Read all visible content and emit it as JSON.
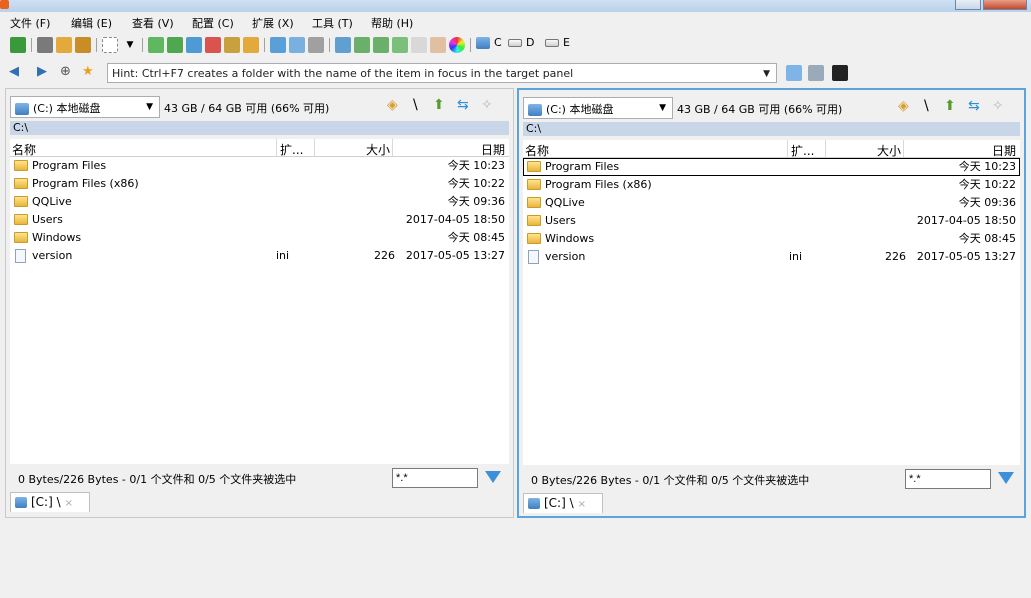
{
  "menu": [
    "文件 (F)",
    "编辑 (E)",
    "查看 (V)",
    "配置 (C)",
    "扩展 (X)",
    "工具 (T)",
    "帮助 (H)"
  ],
  "toolbar": {
    "drives": [
      "C",
      "D",
      "E"
    ]
  },
  "nav": {
    "hint": "Hint: Ctrl+F7 creates a folder with the name of the item in focus in the target panel"
  },
  "left_panel": {
    "drive_label": "(C:) 本地磁盘",
    "drive_info": "43 GB / 64 GB 可用 (66% 可用)",
    "path": "C:\\",
    "columns": {
      "name": "名称",
      "ext": "扩...",
      "size": "大小",
      "date": "日期"
    },
    "rows": [
      {
        "name": "Program Files",
        "ext": "",
        "size": "",
        "date": "今天 10:23",
        "type": "folder"
      },
      {
        "name": "Program Files (x86)",
        "ext": "",
        "size": "",
        "date": "今天 10:22",
        "type": "folder"
      },
      {
        "name": "QQLive",
        "ext": "",
        "size": "",
        "date": "今天 09:36",
        "type": "folder"
      },
      {
        "name": "Users",
        "ext": "",
        "size": "",
        "date": "2017-04-05 18:50",
        "type": "folder"
      },
      {
        "name": "Windows",
        "ext": "",
        "size": "",
        "date": "今天 08:45",
        "type": "folder"
      },
      {
        "name": "version",
        "ext": "ini",
        "size": "226",
        "date": "2017-05-05 13:27",
        "type": "file"
      }
    ],
    "status": "0 Bytes/226 Bytes - 0/1 个文件和 0/5 个文件夹被选中",
    "filter": "*.*",
    "tab": "[C:] \\"
  },
  "right_panel": {
    "drive_label": "(C:) 本地磁盘",
    "drive_info": "43 GB / 64 GB 可用 (66% 可用)",
    "path": "C:\\",
    "columns": {
      "name": "名称",
      "ext": "扩...",
      "size": "大小",
      "date": "日期"
    },
    "rows": [
      {
        "name": "Program Files",
        "ext": "",
        "size": "",
        "date": "今天 10:23",
        "type": "folder"
      },
      {
        "name": "Program Files (x86)",
        "ext": "",
        "size": "",
        "date": "今天 10:22",
        "type": "folder"
      },
      {
        "name": "QQLive",
        "ext": "",
        "size": "",
        "date": "今天 09:36",
        "type": "folder"
      },
      {
        "name": "Users",
        "ext": "",
        "size": "",
        "date": "2017-04-05 18:50",
        "type": "folder"
      },
      {
        "name": "Windows",
        "ext": "",
        "size": "",
        "date": "今天 08:45",
        "type": "folder"
      },
      {
        "name": "version",
        "ext": "ini",
        "size": "226",
        "date": "2017-05-05 13:27",
        "type": "file"
      }
    ],
    "status": "0 Bytes/226 Bytes - 0/1 个文件和 0/5 个文件夹被选中",
    "filter": "*.*",
    "tab": "[C:] \\"
  },
  "colors": {
    "active_panel_border": "#5ea4db",
    "path_bar": "#c8d6e8"
  }
}
